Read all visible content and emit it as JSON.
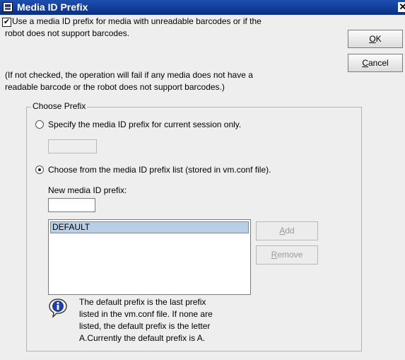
{
  "window": {
    "title": "Media ID Prefix",
    "close_glyph": "✕"
  },
  "use_prefix": {
    "checked": true,
    "check_glyph": "✔",
    "label_line1": "Use a media ID prefix for media with unreadable barcodes or if the",
    "label_line2": "robot does not support barcodes."
  },
  "note": {
    "line1": "(If not checked, the operation will fail if any media does not have a",
    "line2": "readable barcode or the robot does not support barcodes.)"
  },
  "buttons": {
    "ok": "OK",
    "cancel": "Cancel",
    "add": "Add",
    "remove": "Remove"
  },
  "choose_prefix": {
    "legend": "Choose Prefix",
    "option_session": {
      "label": "Specify the media ID prefix for current session only.",
      "checked": false,
      "value": ""
    },
    "option_list": {
      "label": "Choose from the media ID prefix list (stored in vm.conf file).",
      "checked": true
    },
    "new_prefix_label": "New media ID prefix:",
    "new_prefix_value": "",
    "list_items": [
      "DEFAULT"
    ],
    "selected_item": "DEFAULT"
  },
  "info": {
    "icon": "info-icon",
    "line1": "The default prefix is the last prefix",
    "line2": "listed in the vm.conf file.  If none are",
    "line3": "listed, the default prefix is the letter",
    "line4": "A.Currently the default prefix is A."
  },
  "colors": {
    "titlebar": "#0a2f86",
    "selection": "#b8cfe5",
    "background": "#eeeeee"
  }
}
